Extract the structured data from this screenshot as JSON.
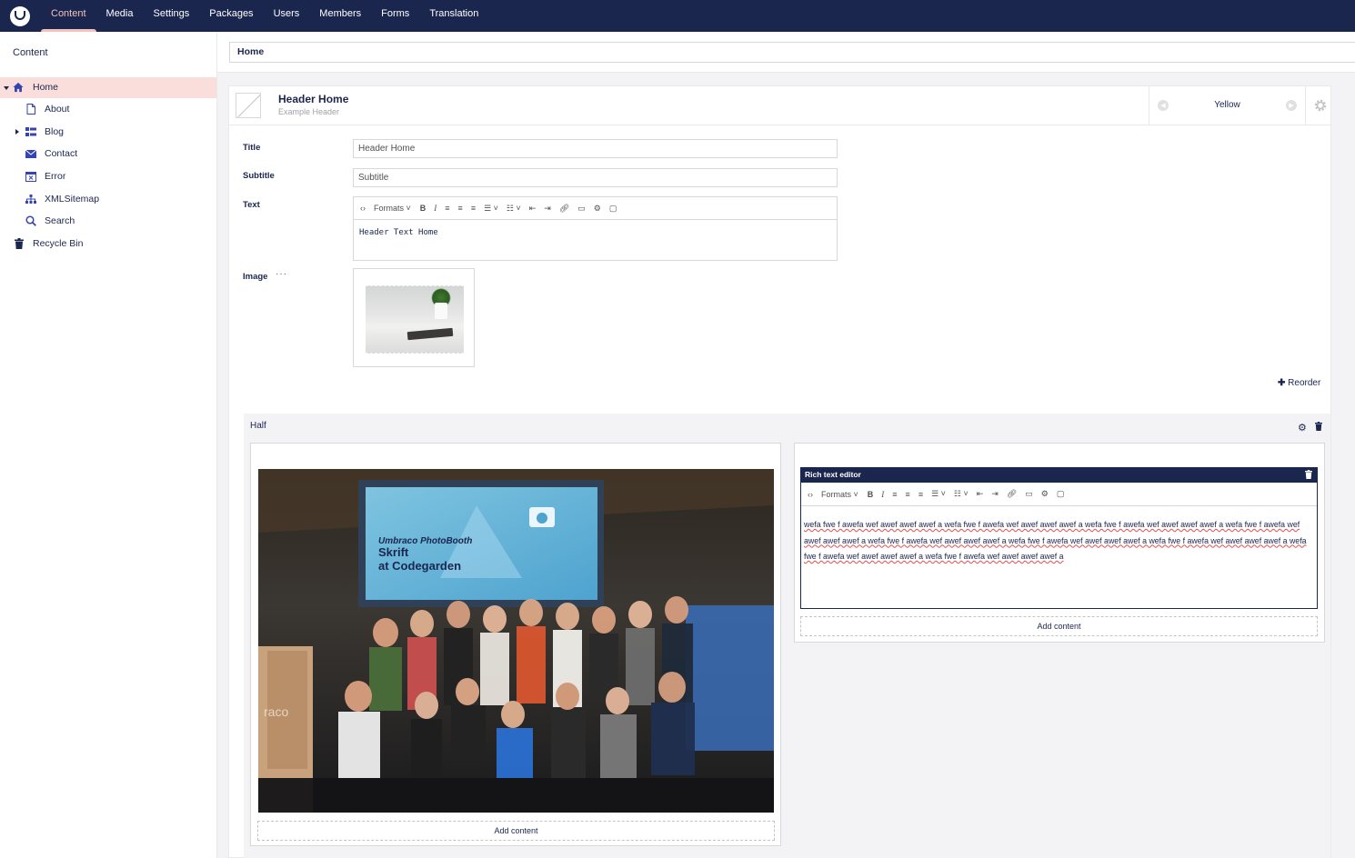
{
  "nav": {
    "items": [
      "Content",
      "Media",
      "Settings",
      "Packages",
      "Users",
      "Members",
      "Forms",
      "Translation"
    ],
    "active": "Content"
  },
  "sidebar": {
    "title": "Content",
    "tree": [
      {
        "label": "Home",
        "icon": "home-icon"
      },
      {
        "label": "About",
        "icon": "document-icon"
      },
      {
        "label": "Blog",
        "icon": "list-icon"
      },
      {
        "label": "Contact",
        "icon": "envelope-icon"
      },
      {
        "label": "Error",
        "icon": "error-page-icon"
      },
      {
        "label": "XMLSitemap",
        "icon": "sitemap-icon"
      },
      {
        "label": "Search",
        "icon": "search-icon"
      },
      {
        "label": "Recycle Bin",
        "icon": "trash-icon"
      }
    ]
  },
  "editor": {
    "node_name": "Home",
    "header_name": "Header Home",
    "header_type": "Example Header",
    "variant": "Yellow",
    "props": {
      "title_label": "Title",
      "title_value": "Header Home",
      "subtitle_label": "Subtitle",
      "subtitle_placeholder": "Subtitle",
      "text_label": "Text",
      "text_value": "Header Text Home",
      "image_label": "Image",
      "image_menu": "···"
    },
    "toolbar": {
      "formats": "Formats"
    },
    "reorder_label": "Reorder"
  },
  "grid": {
    "section_title": "Half",
    "left_add_content": "Add content",
    "rte_block_title": "Rich text editor",
    "rte_text": "wefa fwe f awefa wef awef awef awef a wefa fwe f awefa wef awef awef awef a wefa fwe f awefa wef awef awef awef a wefa fwe f awefa wef awef awef awef a wefa fwe f awefa wef awef awef awef a wefa fwe f awefa wef awef awef awef a wefa fwe f awefa wef awef awef awef a wefa fwe f awefa wef awef awef awef a wefa fwe f awefa wef awef awef awef a",
    "right_add_content": "Add content",
    "photo_sign_title": "Umbraco PhotoBooth",
    "photo_sign_line1": "Skrift",
    "photo_sign_line2": "at Codegarden"
  },
  "colors": {
    "nav_bg": "#1b264f",
    "active_accent": "#f5c1bc",
    "active_tree_bg": "#f9dedb",
    "page_bg": "#f3f3f5"
  }
}
